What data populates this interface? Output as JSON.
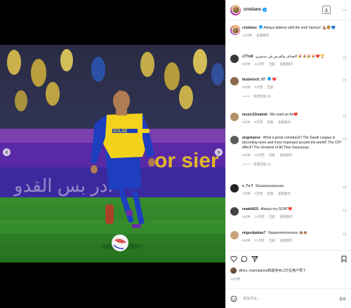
{
  "post": {
    "username": "cristiano",
    "download_label": "下载",
    "more_label": "..."
  },
  "caption": {
    "username": "cristiano",
    "text": "Always believe until the end! Vamos!! 💪🏽🦁💙",
    "meta_time": "12分钟",
    "meta_translate": "查看翻译"
  },
  "comments": [
    {
      "username": "c77m8",
      "text": "الاهداف والفرص في سنتوري 🎉🎉🎉🎉❤️🏆",
      "meta": [
        "8分钟",
        "21次赞",
        "回复",
        "查看翻译"
      ],
      "replies": ""
    },
    {
      "username": "faizbeloch_07",
      "text": "❤️",
      "meta": [
        "8分钟",
        "8次赞",
        "回复"
      ],
      "replies": "查看回复 (5)"
    },
    {
      "username": "music32mahali",
      "text": "We need an Air❤️",
      "meta": [
        "9分钟",
        "9次赞",
        "回复",
        "查看翻译"
      ],
      "replies": ""
    },
    {
      "username": "angelojove",
      "text": "What a great comeback!! The Saudi League is becoming more and more important around the world!! The CR7 effect!! The Greatest of All Time Siuuuuuuu",
      "meta": [
        "9分钟",
        "25次赞",
        "回复",
        "查看翻译"
      ],
      "replies": "查看回复 (4)"
    },
    {
      "username": "v_7x.7",
      "text": "Siuuuuuuuuuuuuu",
      "meta": [
        "7分钟",
        "3次赞",
        "回复",
        "查看翻译"
      ],
      "replies": ""
    },
    {
      "username": "maattili15",
      "text": "Always my GOAT❤️",
      "meta": [
        "9分钟",
        "10次赞",
        "回复",
        "查看翻译"
      ],
      "replies": ""
    },
    {
      "username": "miguelpakao7",
      "text": "Vaaaammmooosss 👏🏽👏🏽",
      "meta": [
        "8分钟",
        "37次赞",
        "回复",
        "查看翻译"
      ],
      "replies": ""
    }
  ],
  "likes": {
    "text": "dinos_marropanos和其他46.2万位用户赞了"
  },
  "post_time": "12分钟",
  "add_comment": {
    "placeholder": "添加评论...",
    "post_label": "发布"
  },
  "colors": {
    "verified": "#0095f6",
    "heart": "#ed4956",
    "kit_yellow": "#f2d21b",
    "kit_blue": "#1d3fbf"
  }
}
